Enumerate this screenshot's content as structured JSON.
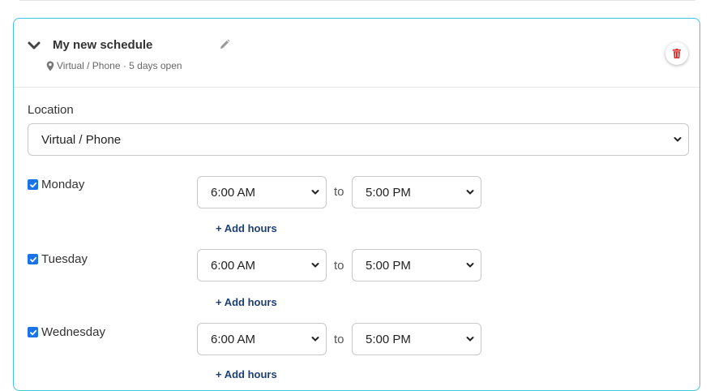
{
  "schedule": {
    "title": "My new schedule",
    "subtitle": "Virtual / Phone · 5 days open"
  },
  "location": {
    "label": "Location",
    "selected": "Virtual / Phone"
  },
  "days": [
    {
      "name": "Monday",
      "checked": true,
      "start": "6:00 AM",
      "to": "to",
      "end": "5:00 PM",
      "add_hours": "+ Add hours"
    },
    {
      "name": "Tuesday",
      "checked": true,
      "start": "6:00 AM",
      "to": "to",
      "end": "5:00 PM",
      "add_hours": "+ Add hours"
    },
    {
      "name": "Wednesday",
      "checked": true,
      "start": "6:00 AM",
      "to": "to",
      "end": "5:00 PM",
      "add_hours": "+ Add hours"
    }
  ],
  "icons": {
    "collapse": "chevron-down-icon",
    "edit": "pencil-icon",
    "location": "map-pin-icon",
    "delete": "trash-icon",
    "checkbox": "checkmark-icon"
  },
  "colors": {
    "card_border": "#3cc7e2",
    "checkbox": "#1a73e8",
    "link": "#1c3f78",
    "delete": "#d9302c"
  }
}
